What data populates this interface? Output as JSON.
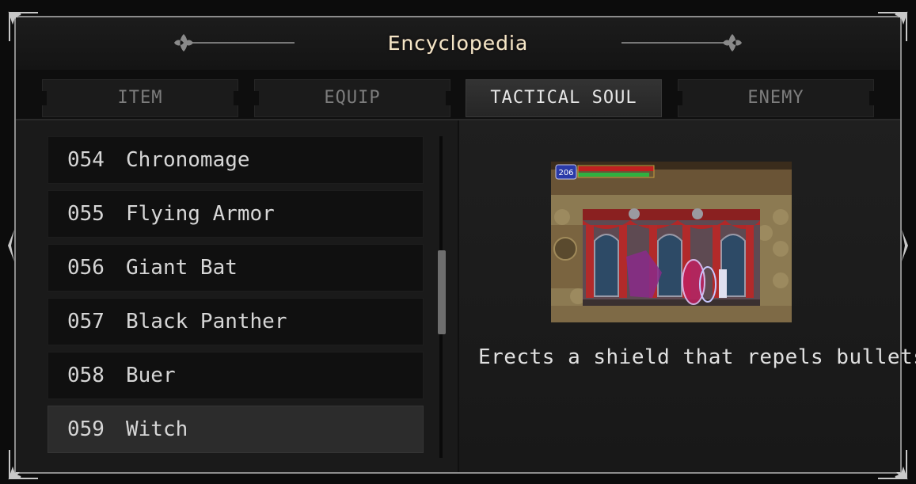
{
  "window": {
    "title": "Encyclopedia"
  },
  "tabs": [
    {
      "label": "ITEM",
      "active": false
    },
    {
      "label": "EQUIP",
      "active": false
    },
    {
      "label": "TACTICAL SOUL",
      "active": true
    },
    {
      "label": "ENEMY",
      "active": false
    }
  ],
  "list": {
    "items": [
      {
        "number": "054",
        "name": "Chronomage"
      },
      {
        "number": "055",
        "name": "Flying Armor"
      },
      {
        "number": "056",
        "name": "Giant Bat"
      },
      {
        "number": "057",
        "name": "Black Panther"
      },
      {
        "number": "058",
        "name": "Buer"
      },
      {
        "number": "059",
        "name": "Witch",
        "selected": true
      }
    ]
  },
  "detail": {
    "hud_hp": "206",
    "description": "Erects a shield that repels bullets."
  },
  "colors": {
    "title": "#f4e6c6",
    "frame": "#8c8c8c",
    "tab_active_text": "#e6e6e6",
    "tab_inactive_text": "#7d7d7d"
  }
}
